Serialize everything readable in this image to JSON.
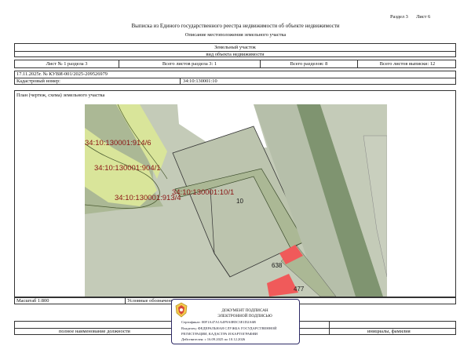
{
  "header": {
    "section_label": "Раздел 3",
    "sheet_label": "Лист 6",
    "title": "Выписка из Единого государственного реестра недвижимости об объекте недвижимости",
    "subtitle": "Описание местоположения земельного участка"
  },
  "object": {
    "type": "Земельный участок",
    "caption": "вид объекта недвижимости"
  },
  "sheets_row": {
    "sheet_of_section": "Лист № 1 раздела 3",
    "section_sheets": "Всего листов раздела 3: 1",
    "total_sections": "Всего разделов: 8",
    "total_sheets": "Всего листов выписки: 12"
  },
  "record": {
    "date_number": "17.11.2025г. № КУВИ-001/2025-209526979",
    "cadastral_label": "Кадастровый номер:",
    "cadastral_value": "34:10:130001:10"
  },
  "plan": {
    "caption": "План (чертеж, схема) земельного участка",
    "labels": {
      "a": "34:10:130001:914/6",
      "b": "34:10:130001:904/1",
      "c": "34:10:130001:913/4",
      "d": "34:10:130001:10/1",
      "main": "10",
      "n638": "638",
      "n477": "477"
    }
  },
  "footer": {
    "scale": "Масштаб 1:800",
    "legend": "Условные обозначения:",
    "position": "полное наименование должности",
    "initials": "инициалы, фамилия"
  },
  "stamp": {
    "line1": "ДОКУМЕНТ ПОДПИСАН",
    "line2": "ЭЛЕКТРОННОЙ ПОДПИСЬЮ",
    "cert": "Сертификат: 00F1A47A1A4F9A0B5C3E1D2A6B",
    "owner": "Владелец: ФЕДЕРАЛЬНАЯ СЛУЖБА ГОСУДАРСТВЕННОЙ",
    "owner2": "РЕГИСТРАЦИИ, КАДАСТРА И КАРТОГРАФИИ",
    "valid": "Действителен: с 16.09.2025 по 10.12.2026"
  },
  "colors": {
    "plan_grey": "#c4cbb8",
    "plan_olive": "#abb895",
    "plan_lime": "#d9e59a",
    "plan_dark_strip": "#7f9470",
    "plan_red": "#f05a5a",
    "label_red": "#8b1414",
    "stamp_border": "#2e2a66"
  }
}
